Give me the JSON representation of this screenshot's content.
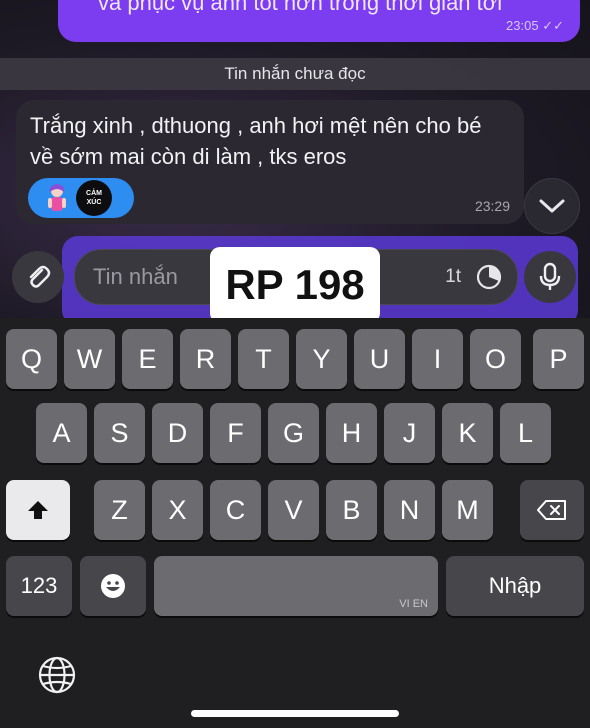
{
  "chat": {
    "outgoing_message": {
      "text": "và phục vụ anh tốt hơn trong thời gian tới",
      "time": "23:05"
    },
    "unread_separator": "Tin nhắn chưa đọc",
    "incoming_message": {
      "text": "Trắng xinh , dthuong , anh hơi mệt nên cho bé về sớm mai còn di làm , tks eros",
      "time": "23:29",
      "sticker_pill": {
        "emotion_badge_line1": "CẢM",
        "emotion_badge_line2": "XÚC"
      }
    }
  },
  "composer": {
    "placeholder": "Tin nhắn",
    "timer_value": "1t"
  },
  "overlay_label": "RP 198",
  "keyboard": {
    "row1": [
      "Q",
      "W",
      "E",
      "R",
      "T",
      "Y",
      "U",
      "I",
      "O",
      "P"
    ],
    "row2": [
      "A",
      "S",
      "D",
      "F",
      "G",
      "H",
      "J",
      "K",
      "L"
    ],
    "row3": [
      "Z",
      "X",
      "C",
      "V",
      "B",
      "N",
      "M"
    ],
    "numbers_key": "123",
    "space_language": "VI EN",
    "return_key": "Nhập"
  },
  "colors": {
    "accent_purple": "#7c3cf0",
    "sticker_blue": "#2e8df0",
    "key_gray": "#6c6c70"
  }
}
